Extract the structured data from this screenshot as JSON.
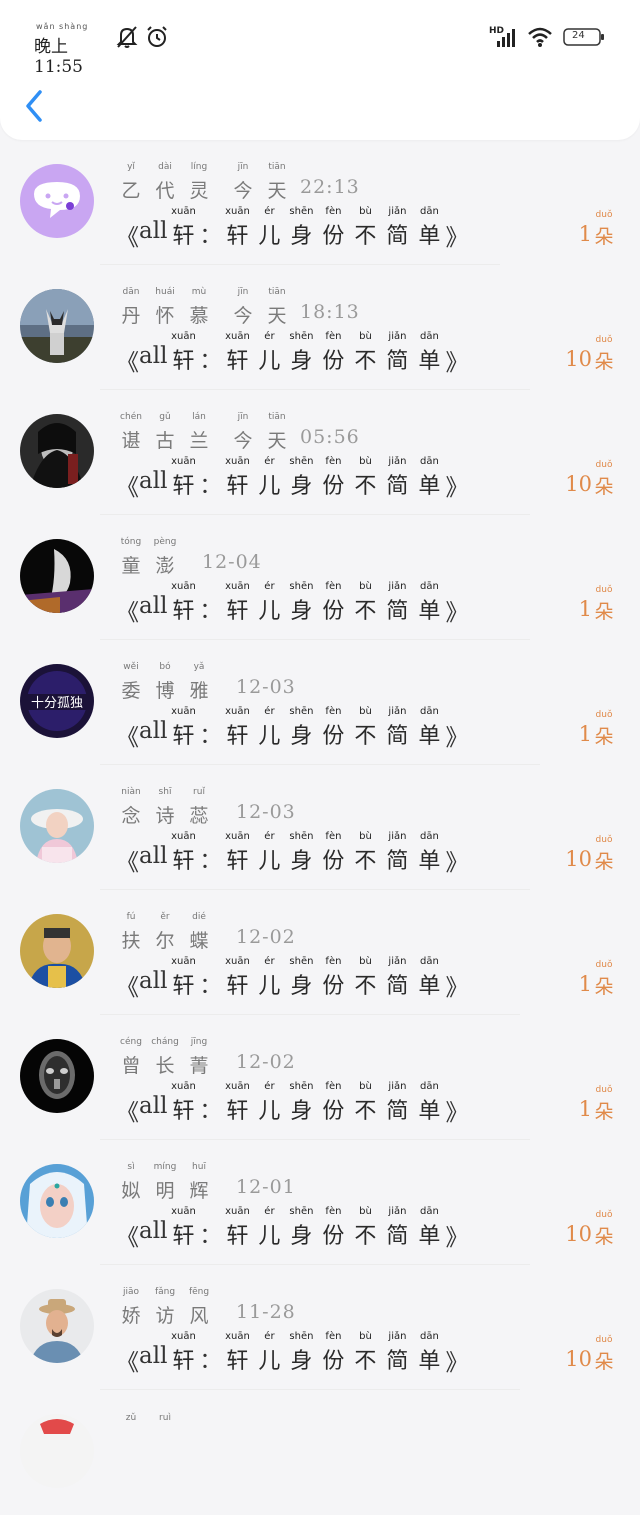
{
  "status_bar": {
    "time_pinyin": "wǎn shàng",
    "time": "晚上11:55",
    "hd_label": "HD",
    "battery": "24"
  },
  "messages": {
    "prefix_bracket": "《",
    "prefix_all": "all",
    "suffix_bracket": "》",
    "colon": "：",
    "text_chars": [
      {
        "char": "轩",
        "pinyin": "xuān"
      },
      {
        "char": "轩",
        "pinyin": "xuān"
      },
      {
        "char": "儿",
        "pinyin": "ér"
      },
      {
        "char": "身",
        "pinyin": "shēn"
      },
      {
        "char": "份",
        "pinyin": "fèn"
      },
      {
        "char": "不",
        "pinyin": "bù"
      },
      {
        "char": "简",
        "pinyin": "jiǎn"
      },
      {
        "char": "单",
        "pinyin": "dān"
      }
    ],
    "unit": {
      "char": "朵",
      "pinyin": "duǒ"
    }
  },
  "rows": [
    {
      "name": [
        {
          "char": "乙",
          "pinyin": "yǐ"
        },
        {
          "char": "代",
          "pinyin": "dài"
        },
        {
          "char": "灵",
          "pinyin": "líng"
        }
      ],
      "date_chars": [
        {
          "char": "今",
          "pinyin": "jīn"
        },
        {
          "char": "天",
          "pinyin": "tiān"
        }
      ],
      "time": "22:13",
      "count": "1",
      "avatar": "chat-bubble"
    },
    {
      "name": [
        {
          "char": "丹",
          "pinyin": "dān"
        },
        {
          "char": "怀",
          "pinyin": "huái"
        },
        {
          "char": "慕",
          "pinyin": "mù"
        }
      ],
      "date_chars": [
        {
          "char": "今",
          "pinyin": "jīn"
        },
        {
          "char": "天",
          "pinyin": "tiān"
        }
      ],
      "time": "18:13",
      "count": "10",
      "avatar": "husky"
    },
    {
      "name": [
        {
          "char": "谌",
          "pinyin": "chén"
        },
        {
          "char": "古",
          "pinyin": "gǔ"
        },
        {
          "char": "兰",
          "pinyin": "lán"
        }
      ],
      "date_chars": [
        {
          "char": "今",
          "pinyin": "jīn"
        },
        {
          "char": "天",
          "pinyin": "tiān"
        }
      ],
      "time": "05:56",
      "count": "10",
      "avatar": "dark-portrait"
    },
    {
      "name": [
        {
          "char": "童",
          "pinyin": "tóng"
        },
        {
          "char": "澎",
          "pinyin": "pèng"
        }
      ],
      "date_chars": [],
      "time": "12-04",
      "count": "1",
      "avatar": "smoke-portrait"
    },
    {
      "name": [
        {
          "char": "委",
          "pinyin": "wěi"
        },
        {
          "char": "博",
          "pinyin": "bó"
        },
        {
          "char": "雅",
          "pinyin": "yǎ"
        }
      ],
      "date_chars": [],
      "time": "12-03",
      "count": "1",
      "avatar": "neon-text",
      "avatar_text": "十分孤独"
    },
    {
      "name": [
        {
          "char": "念",
          "pinyin": "niàn"
        },
        {
          "char": "诗",
          "pinyin": "shī"
        },
        {
          "char": "蕊",
          "pinyin": "ruǐ"
        }
      ],
      "date_chars": [],
      "time": "12-03",
      "count": "10",
      "avatar": "girl-hat"
    },
    {
      "name": [
        {
          "char": "扶",
          "pinyin": "fú"
        },
        {
          "char": "尔",
          "pinyin": "ěr"
        },
        {
          "char": "蝶",
          "pinyin": "dié"
        }
      ],
      "date_chars": [],
      "time": "12-02",
      "count": "1",
      "avatar": "costume-man"
    },
    {
      "name": [
        {
          "char": "曾",
          "pinyin": "céng"
        },
        {
          "char": "长",
          "pinyin": "cháng"
        },
        {
          "char": "菁",
          "pinyin": "jīng"
        }
      ],
      "date_chars": [],
      "time": "12-02",
      "count": "1",
      "avatar": "metal-mask"
    },
    {
      "name": [
        {
          "char": "姒",
          "pinyin": "sì"
        },
        {
          "char": "明",
          "pinyin": "míng"
        },
        {
          "char": "辉",
          "pinyin": "huī"
        }
      ],
      "date_chars": [],
      "time": "12-01",
      "count": "10",
      "avatar": "animated-girl"
    },
    {
      "name": [
        {
          "char": "娇",
          "pinyin": "jiāo"
        },
        {
          "char": "访",
          "pinyin": "fǎng"
        },
        {
          "char": "风",
          "pinyin": "fēng"
        }
      ],
      "date_chars": [],
      "time": "11-28",
      "count": "10",
      "avatar": "hat-man"
    },
    {
      "name": [
        {
          "char": "",
          "pinyin": "zǔ"
        },
        {
          "char": "",
          "pinyin": "ruì"
        }
      ],
      "date_chars": [],
      "time": "",
      "count": "",
      "avatar": "partial-red"
    }
  ],
  "colors": {
    "accent_blue": "#2f8ff5",
    "count_orange": "#e08a4a",
    "avatar_purple": "#c9a6f2"
  }
}
